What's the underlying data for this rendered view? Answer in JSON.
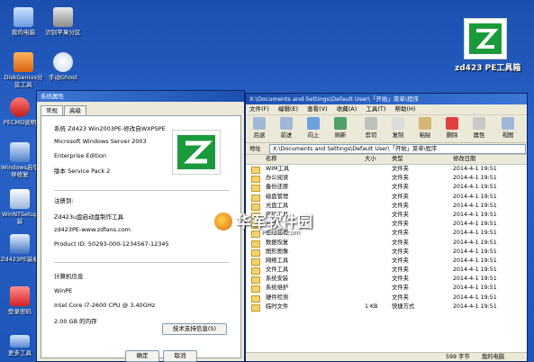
{
  "desktop": {
    "icons": [
      {
        "label": "我的电脑",
        "icon": "computer-icon"
      },
      {
        "label": "识别苹果分区",
        "icon": "disk-icon"
      },
      {
        "label": "DiskGenius分区工具",
        "icon": "diskgenius-icon"
      },
      {
        "label": "手动Ghost",
        "icon": "ghost-icon"
      },
      {
        "label": "PECMD说明",
        "icon": "help-icon"
      },
      {
        "label": "Windows启引导修复",
        "icon": "repair-icon"
      },
      {
        "label": "WinNTSetup装",
        "icon": "setup-icon"
      },
      {
        "label": "Zd423PE装机",
        "icon": "zd423-icon"
      },
      {
        "label": "登录密码",
        "icon": "password-icon"
      },
      {
        "label": "更多工具",
        "icon": "tools-icon"
      }
    ],
    "brand_title": "zd423 PE工具箱"
  },
  "dialog": {
    "title": "系统属性",
    "tabs": [
      "常规",
      "高级"
    ],
    "system_label": "系统 Zd423 Win2003PE-修改自WXPSPE",
    "os": "Microsoft Windows Server 2003",
    "edition": "Enterprise Edition",
    "version": "版本 Service Pack 2",
    "registered_label": "注册到:",
    "reg_name": "Zd423u盘启动盘制作工具",
    "reg_site": "zd423PE-www.zdfans.com",
    "product_id": "Product ID:       50293-000-1234567-12345",
    "computer_label": "计算机信息",
    "computer_name": "WinPE",
    "cpu": "Intel Core i7-2600 CPU @ 3.40GHz",
    "ram": "2.00 GB 的内存",
    "support_button": "技术支持信息(S)",
    "ok_button": "确定",
    "cancel_button": "取消"
  },
  "explorer": {
    "title": "X:\\Documents and Settings\\Default User\\「开始」菜单\\程序",
    "menu": [
      "文件(F)",
      "编辑(E)",
      "查看(V)",
      "收藏(A)",
      "工具(T)",
      "帮助(H)"
    ],
    "toolbar": [
      "后退",
      "前进",
      "向上",
      "刷新",
      "剪切",
      "复制",
      "粘贴",
      "删除",
      "属性",
      "视图"
    ],
    "address_label": "地址",
    "address": "X:\\Documents and Settings\\Default User\\「开始」菜单\\程序",
    "columns": [
      "名称",
      "大小",
      "类型",
      "修改日期"
    ],
    "rows": [
      {
        "name": "WIM工具",
        "size": "",
        "type": "文件夹",
        "date": "2014-4-1 19:51"
      },
      {
        "name": "办公阅读",
        "size": "",
        "type": "文件夹",
        "date": "2014-4-1 19:51"
      },
      {
        "name": "备份还原",
        "size": "",
        "type": "文件夹",
        "date": "2014-4-1 19:51"
      },
      {
        "name": "磁盘管理",
        "size": "",
        "type": "文件夹",
        "date": "2014-4-1 19:51"
      },
      {
        "name": "光盘工具",
        "size": "",
        "type": "文件夹",
        "date": "2014-4-1 19:51"
      },
      {
        "name": "密码工具",
        "size": "",
        "type": "文件夹",
        "date": "2014-4-1 19:51"
      },
      {
        "name": "启动",
        "size": "",
        "type": "文件夹",
        "date": "2014-4-1 19:51"
      },
      {
        "name": "驱动管理",
        "size": "",
        "type": "文件夹",
        "date": "2014-4-1 19:51"
      },
      {
        "name": "数据恢复",
        "size": "",
        "type": "文件夹",
        "date": "2014-4-1 19:51"
      },
      {
        "name": "图形图像",
        "size": "",
        "type": "文件夹",
        "date": "2014-4-1 19:51"
      },
      {
        "name": "网络工具",
        "size": "",
        "type": "文件夹",
        "date": "2014-4-1 19:51"
      },
      {
        "name": "文件工具",
        "size": "",
        "type": "文件夹",
        "date": "2014-4-1 19:51"
      },
      {
        "name": "系统安装",
        "size": "",
        "type": "文件夹",
        "date": "2014-4-1 19:51"
      },
      {
        "name": "系统维护",
        "size": "",
        "type": "文件夹",
        "date": "2014-4-1 19:51"
      },
      {
        "name": "硬件检测",
        "size": "",
        "type": "文件夹",
        "date": "2014-4-1 19:51"
      },
      {
        "name": "临时文件",
        "size": "1 KB",
        "type": "快捷方式",
        "date": "2014-4-1 19:51"
      }
    ],
    "status_size": "599 字节",
    "status_location": "我的电脑"
  },
  "watermark": {
    "text": "华军软件园",
    "url": "www.onlinedown.net / newasp: www.pcsoft.com.cn",
    "sub": "PCcolor.com"
  },
  "colors": {
    "desktop": "#1d54b6",
    "brand_green": "#1a9a3a",
    "titlebar": "#1c4fb0"
  }
}
